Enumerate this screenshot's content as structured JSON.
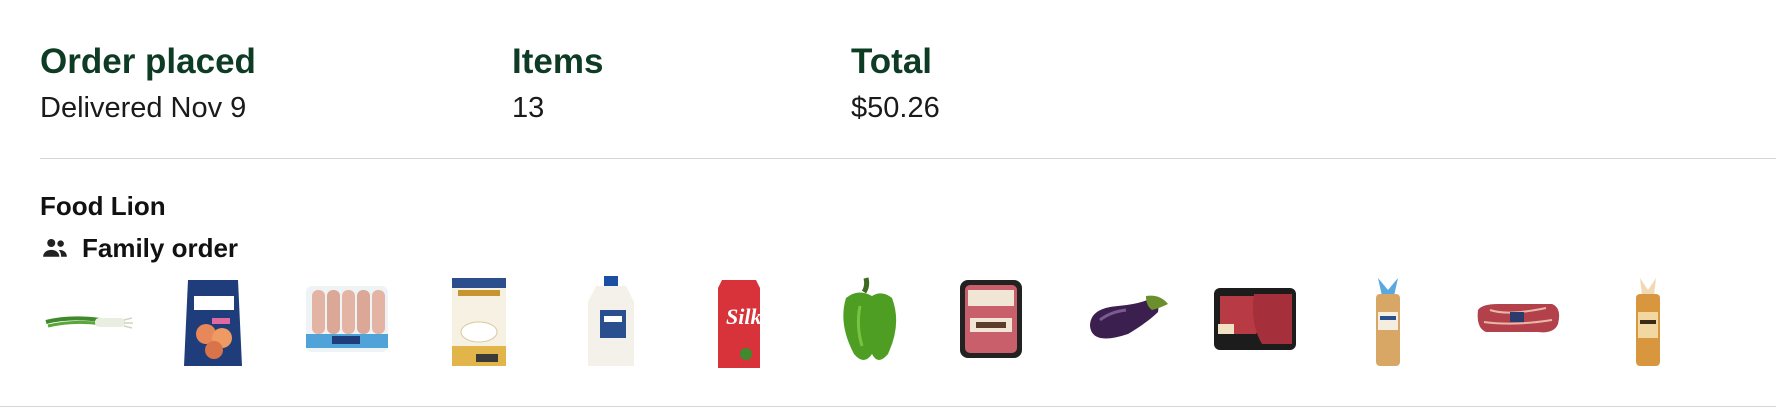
{
  "order": {
    "placed_label": "Order placed",
    "placed_value": "Delivered Nov 9",
    "items_label": "Items",
    "items_value": "13",
    "total_label": "Total",
    "total_value": "$50.26"
  },
  "store": {
    "name": "Food Lion",
    "family_label": "Family order",
    "family_icon": "people-icon"
  },
  "product_thumbs": [
    {
      "icon": "green-onion-icon"
    },
    {
      "icon": "shrimp-bag-icon"
    },
    {
      "icon": "sausage-pack-icon"
    },
    {
      "icon": "corn-starch-box-icon"
    },
    {
      "icon": "milk-jug-icon"
    },
    {
      "icon": "silk-carton-icon"
    },
    {
      "icon": "green-pepper-icon"
    },
    {
      "icon": "ground-beef-pack-icon"
    },
    {
      "icon": "eggplant-icon"
    },
    {
      "icon": "steak-tray-icon"
    },
    {
      "icon": "bread-loaf-icon"
    },
    {
      "icon": "beef-roast-icon"
    },
    {
      "icon": "wheat-bread-icon"
    }
  ],
  "colors": {
    "heading": "#0e3b24",
    "text": "#1a1a1a",
    "divider": "#d4d4d4"
  }
}
